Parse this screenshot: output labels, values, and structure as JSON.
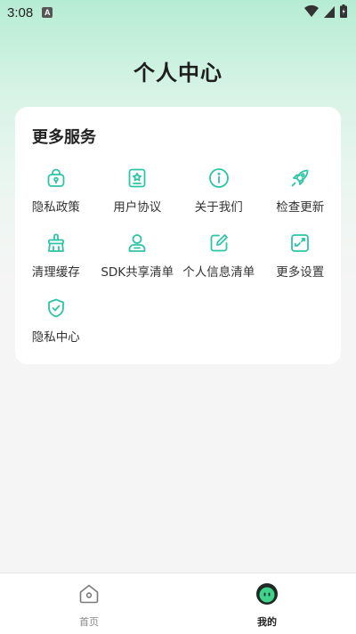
{
  "status_bar": {
    "time": "3:08",
    "notification_badge": "A"
  },
  "page": {
    "title": "个人中心"
  },
  "services": {
    "title": "更多服务",
    "items": [
      {
        "label": "隐私政策",
        "icon": "lock-bag-icon"
      },
      {
        "label": "用户协议",
        "icon": "star-document-icon"
      },
      {
        "label": "关于我们",
        "icon": "info-icon"
      },
      {
        "label": "检查更新",
        "icon": "rocket-icon"
      },
      {
        "label": "清理缓存",
        "icon": "broom-icon"
      },
      {
        "label": "SDK共享清单",
        "icon": "user-icon"
      },
      {
        "label": "个人信息清单",
        "icon": "edit-icon"
      },
      {
        "label": "更多设置",
        "icon": "settings-square-icon"
      },
      {
        "label": "隐私中心",
        "icon": "shield-check-icon"
      }
    ]
  },
  "bottom_nav": {
    "tabs": [
      {
        "label": "首页",
        "icon": "home-icon",
        "active": false
      },
      {
        "label": "我的",
        "icon": "profile-face-icon",
        "active": true
      }
    ]
  },
  "colors": {
    "accent": "#2ec4a5",
    "header_gradient_top": "#b6ecd3",
    "background": "#f5f5f5"
  }
}
